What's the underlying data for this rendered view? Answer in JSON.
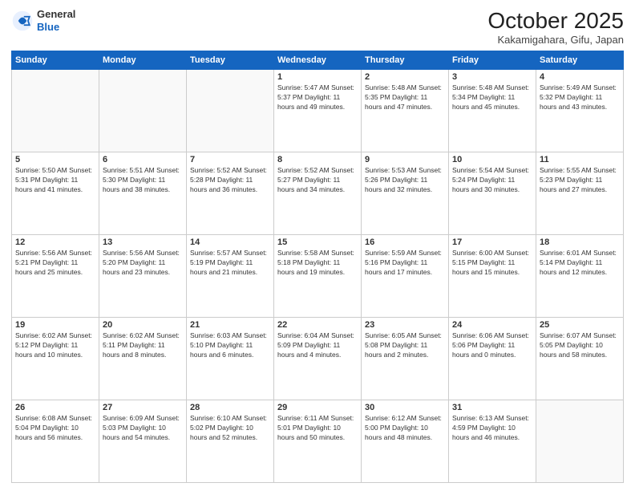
{
  "header": {
    "logo_general": "General",
    "logo_blue": "Blue",
    "month_title": "October 2025",
    "location": "Kakamigahara, Gifu, Japan"
  },
  "days_of_week": [
    "Sunday",
    "Monday",
    "Tuesday",
    "Wednesday",
    "Thursday",
    "Friday",
    "Saturday"
  ],
  "weeks": [
    [
      {
        "day": "",
        "info": ""
      },
      {
        "day": "",
        "info": ""
      },
      {
        "day": "",
        "info": ""
      },
      {
        "day": "1",
        "info": "Sunrise: 5:47 AM\nSunset: 5:37 PM\nDaylight: 11 hours\nand 49 minutes."
      },
      {
        "day": "2",
        "info": "Sunrise: 5:48 AM\nSunset: 5:35 PM\nDaylight: 11 hours\nand 47 minutes."
      },
      {
        "day": "3",
        "info": "Sunrise: 5:48 AM\nSunset: 5:34 PM\nDaylight: 11 hours\nand 45 minutes."
      },
      {
        "day": "4",
        "info": "Sunrise: 5:49 AM\nSunset: 5:32 PM\nDaylight: 11 hours\nand 43 minutes."
      }
    ],
    [
      {
        "day": "5",
        "info": "Sunrise: 5:50 AM\nSunset: 5:31 PM\nDaylight: 11 hours\nand 41 minutes."
      },
      {
        "day": "6",
        "info": "Sunrise: 5:51 AM\nSunset: 5:30 PM\nDaylight: 11 hours\nand 38 minutes."
      },
      {
        "day": "7",
        "info": "Sunrise: 5:52 AM\nSunset: 5:28 PM\nDaylight: 11 hours\nand 36 minutes."
      },
      {
        "day": "8",
        "info": "Sunrise: 5:52 AM\nSunset: 5:27 PM\nDaylight: 11 hours\nand 34 minutes."
      },
      {
        "day": "9",
        "info": "Sunrise: 5:53 AM\nSunset: 5:26 PM\nDaylight: 11 hours\nand 32 minutes."
      },
      {
        "day": "10",
        "info": "Sunrise: 5:54 AM\nSunset: 5:24 PM\nDaylight: 11 hours\nand 30 minutes."
      },
      {
        "day": "11",
        "info": "Sunrise: 5:55 AM\nSunset: 5:23 PM\nDaylight: 11 hours\nand 27 minutes."
      }
    ],
    [
      {
        "day": "12",
        "info": "Sunrise: 5:56 AM\nSunset: 5:21 PM\nDaylight: 11 hours\nand 25 minutes."
      },
      {
        "day": "13",
        "info": "Sunrise: 5:56 AM\nSunset: 5:20 PM\nDaylight: 11 hours\nand 23 minutes."
      },
      {
        "day": "14",
        "info": "Sunrise: 5:57 AM\nSunset: 5:19 PM\nDaylight: 11 hours\nand 21 minutes."
      },
      {
        "day": "15",
        "info": "Sunrise: 5:58 AM\nSunset: 5:18 PM\nDaylight: 11 hours\nand 19 minutes."
      },
      {
        "day": "16",
        "info": "Sunrise: 5:59 AM\nSunset: 5:16 PM\nDaylight: 11 hours\nand 17 minutes."
      },
      {
        "day": "17",
        "info": "Sunrise: 6:00 AM\nSunset: 5:15 PM\nDaylight: 11 hours\nand 15 minutes."
      },
      {
        "day": "18",
        "info": "Sunrise: 6:01 AM\nSunset: 5:14 PM\nDaylight: 11 hours\nand 12 minutes."
      }
    ],
    [
      {
        "day": "19",
        "info": "Sunrise: 6:02 AM\nSunset: 5:12 PM\nDaylight: 11 hours\nand 10 minutes."
      },
      {
        "day": "20",
        "info": "Sunrise: 6:02 AM\nSunset: 5:11 PM\nDaylight: 11 hours\nand 8 minutes."
      },
      {
        "day": "21",
        "info": "Sunrise: 6:03 AM\nSunset: 5:10 PM\nDaylight: 11 hours\nand 6 minutes."
      },
      {
        "day": "22",
        "info": "Sunrise: 6:04 AM\nSunset: 5:09 PM\nDaylight: 11 hours\nand 4 minutes."
      },
      {
        "day": "23",
        "info": "Sunrise: 6:05 AM\nSunset: 5:08 PM\nDaylight: 11 hours\nand 2 minutes."
      },
      {
        "day": "24",
        "info": "Sunrise: 6:06 AM\nSunset: 5:06 PM\nDaylight: 11 hours\nand 0 minutes."
      },
      {
        "day": "25",
        "info": "Sunrise: 6:07 AM\nSunset: 5:05 PM\nDaylight: 10 hours\nand 58 minutes."
      }
    ],
    [
      {
        "day": "26",
        "info": "Sunrise: 6:08 AM\nSunset: 5:04 PM\nDaylight: 10 hours\nand 56 minutes."
      },
      {
        "day": "27",
        "info": "Sunrise: 6:09 AM\nSunset: 5:03 PM\nDaylight: 10 hours\nand 54 minutes."
      },
      {
        "day": "28",
        "info": "Sunrise: 6:10 AM\nSunset: 5:02 PM\nDaylight: 10 hours\nand 52 minutes."
      },
      {
        "day": "29",
        "info": "Sunrise: 6:11 AM\nSunset: 5:01 PM\nDaylight: 10 hours\nand 50 minutes."
      },
      {
        "day": "30",
        "info": "Sunrise: 6:12 AM\nSunset: 5:00 PM\nDaylight: 10 hours\nand 48 minutes."
      },
      {
        "day": "31",
        "info": "Sunrise: 6:13 AM\nSunset: 4:59 PM\nDaylight: 10 hours\nand 46 minutes."
      },
      {
        "day": "",
        "info": ""
      }
    ]
  ]
}
